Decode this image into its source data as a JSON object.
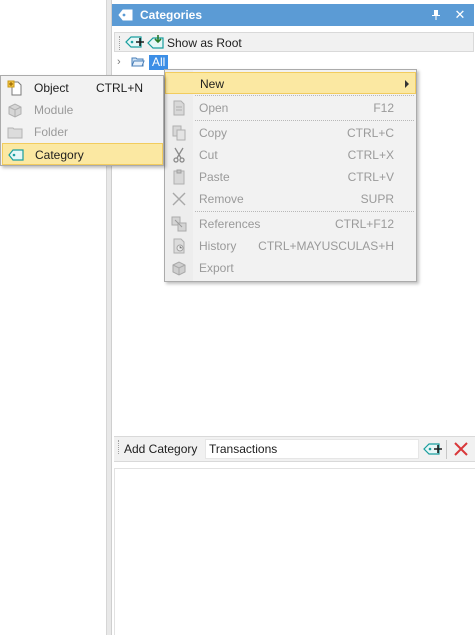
{
  "panel": {
    "title": "Categories",
    "pin_glyph": "↑",
    "close_glyph": "✕"
  },
  "toolbar": {
    "show_as_root_label": "Show as Root"
  },
  "tree": {
    "root_label": "All"
  },
  "context_menu": {
    "items": [
      {
        "label": "New",
        "shortcut": "",
        "enabled": true,
        "submenu": true,
        "icon": "none"
      },
      {
        "label": "Open",
        "shortcut": "F12",
        "enabled": false,
        "icon": "document-icon"
      },
      {
        "label": "Copy",
        "shortcut": "CTRL+C",
        "enabled": false,
        "icon": "copy-icon"
      },
      {
        "label": "Cut",
        "shortcut": "CTRL+X",
        "enabled": false,
        "icon": "scissors-icon"
      },
      {
        "label": "Paste",
        "shortcut": "CTRL+V",
        "enabled": false,
        "icon": "clipboard-icon"
      },
      {
        "label": "Remove",
        "shortcut": "SUPR",
        "enabled": false,
        "icon": "x-mark-icon"
      },
      {
        "label": "References",
        "shortcut": "CTRL+F12",
        "enabled": false,
        "icon": "references-icon"
      },
      {
        "label": "History",
        "shortcut": "CTRL+MAYUSCULAS+H",
        "enabled": false,
        "icon": "history-icon"
      },
      {
        "label": "Export",
        "shortcut": "",
        "enabled": false,
        "icon": "export-box-icon"
      }
    ]
  },
  "new_submenu": {
    "items": [
      {
        "label": "Object",
        "shortcut": "CTRL+N",
        "enabled": true,
        "icon": "new-object-icon"
      },
      {
        "label": "Module",
        "shortcut": "",
        "enabled": false,
        "icon": "module-cube-icon"
      },
      {
        "label": "Folder",
        "shortcut": "",
        "enabled": false,
        "icon": "folder-icon"
      },
      {
        "label": "Category",
        "shortcut": "",
        "enabled": true,
        "highlighted": true,
        "icon": "category-tag-icon"
      }
    ]
  },
  "add_category": {
    "label": "Add Category",
    "value": "Transactions"
  },
  "colors": {
    "title_bar": "#5b9bd5",
    "selection": "#3c8ee6",
    "menu_highlight": "#fbe8a2",
    "delete_red": "#d9383a",
    "category_teal": "#1a9e9e"
  }
}
